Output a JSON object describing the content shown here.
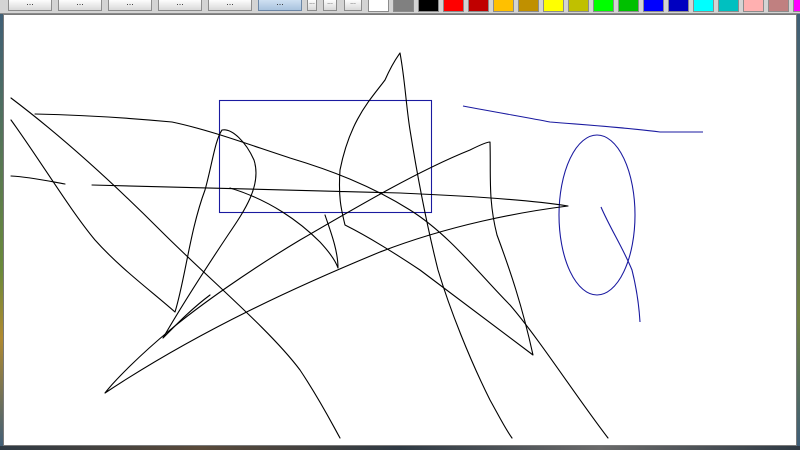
{
  "toolbar": {
    "buttons": [
      {
        "name": "tool-button-1",
        "label": "...",
        "active": false
      },
      {
        "name": "tool-button-2",
        "label": "...",
        "active": false
      },
      {
        "name": "tool-button-3",
        "label": "...",
        "active": false
      },
      {
        "name": "tool-button-4",
        "label": "...",
        "active": false
      },
      {
        "name": "tool-button-5",
        "label": "...",
        "active": false
      },
      {
        "name": "tool-button-6",
        "label": "...",
        "active": true
      }
    ],
    "small_buttons": [
      {
        "name": "small-button-1",
        "label": "..."
      },
      {
        "name": "small-button-2",
        "label": "..."
      },
      {
        "name": "small-button-3",
        "label": "..."
      }
    ],
    "palette": [
      "#ffffff",
      "#808080",
      "#000000",
      "#ff0000",
      "#c00000",
      "#ffc000",
      "#c09000",
      "#ffff00",
      "#c0c000",
      "#00ff00",
      "#00c000",
      "#0000ff",
      "#0000c0",
      "#00ffff",
      "#00c0c0",
      "#ffb0b0",
      "#c08080",
      "#ff00ff",
      "#c000c0"
    ]
  },
  "canvas": {
    "stroke_colors": {
      "freehand": "#000000",
      "shapes": "#1a1aa0"
    }
  }
}
